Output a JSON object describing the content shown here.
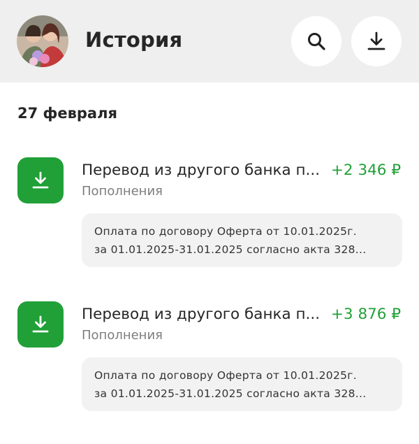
{
  "header": {
    "title": "История",
    "avatar_icon": "user-avatar-photo",
    "search_icon": "search-icon",
    "download_icon": "download-icon"
  },
  "section": {
    "date": "27 февраля"
  },
  "colors": {
    "accent_green": "#21a038",
    "header_bg": "#efefef",
    "note_bg": "#f2f2f2"
  },
  "transactions": [
    {
      "title": "Перевод из другого банка п...",
      "amount": "+2 346 ₽",
      "category": "Пополнения",
      "note_line1": "Оплата по договору Оферта от 10.01.2025г.",
      "note_line2": "за 01.01.2025-31.01.2025 согласно акта 328...",
      "icon": "incoming-transfer-icon"
    },
    {
      "title": "Перевод из другого банка п...",
      "amount": "+3 876 ₽",
      "category": "Пополнения",
      "note_line1": "Оплата по договору Оферта от 10.01.2025г.",
      "note_line2": "за 01.01.2025-31.01.2025 согласно акта 328...",
      "icon": "incoming-transfer-icon"
    }
  ]
}
